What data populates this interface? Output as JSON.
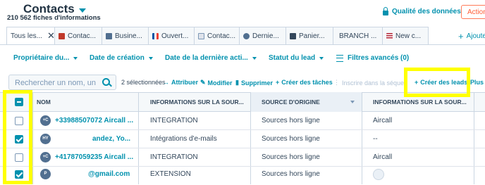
{
  "header": {
    "title": "Contacts",
    "count": "210 562 fiches d'informations",
    "quality_label": "Qualité des données",
    "actions_label": "Action"
  },
  "tabs": [
    {
      "label": "Tous les...",
      "icon": "none",
      "active": true,
      "closable": true
    },
    {
      "label": "Contac...",
      "icon": "briefcase-icon",
      "color": "#c0392b"
    },
    {
      "label": "Busine...",
      "icon": "briefcase-icon",
      "color": "#516f90"
    },
    {
      "label": "Ouvert...",
      "icon": "flag-fr-icon",
      "color": "#0055a4"
    },
    {
      "label": "Contac...",
      "icon": "envelope-icon",
      "color": "#cbd6e2"
    },
    {
      "label": "Dernie...",
      "icon": "speech-icon",
      "color": "#516f90"
    },
    {
      "label": "Panier...",
      "icon": "cart-icon",
      "color": "#33475b"
    },
    {
      "label": "BRANCH ...",
      "icon": "none"
    },
    {
      "label": "New c...",
      "icon": "flag-us-icon",
      "color": "#b22234"
    }
  ],
  "add_view_label": "Ajoute",
  "filters": [
    {
      "label": "Propriétaire du..."
    },
    {
      "label": "Date de création"
    },
    {
      "label": "Date de la dernière acti..."
    },
    {
      "label": "Statut du lead"
    }
  ],
  "advanced_filters_label": "Filtres avancés (0)",
  "search": {
    "placeholder": "Rechercher un nom, un n",
    "value": ""
  },
  "bulk_actions": {
    "selected": "2 sélectionnées",
    "assign": "Attribuer",
    "edit": "Modifier",
    "delete": "Supprimer",
    "create_tasks": "Créer des tâches",
    "enroll_sequence": "Inscrire dans la séquence",
    "create_leads": "Créer des leads",
    "more": "Plus"
  },
  "columns": {
    "name": "NOM",
    "source_info_1": "INFORMATIONS SUR LA SOUR...",
    "origin_source": "SOURCE D'ORIGINE",
    "source_info_2": "INFORMATIONS SUR LA SOUR..."
  },
  "rows": [
    {
      "initials": "+C",
      "name": "+33988507072 Aircall ...",
      "info1": "INTEGRATION",
      "origin": "Sources hors ligne",
      "info2": "Aircall",
      "checked": false
    },
    {
      "initials": "HY",
      "name": "andez, Yo...",
      "info1": "Intégrations d'e-mails",
      "origin": "Sources hors ligne",
      "info2": "--",
      "checked": true
    },
    {
      "initials": "+C",
      "name": "+41787059235 Aircall ...",
      "info1": "INTEGRATION",
      "origin": "Sources hors ligne",
      "info2": "Aircall",
      "checked": false
    },
    {
      "initials": "P",
      "name": "@gmail.com",
      "info1": "EXTENSION",
      "origin": "Sources hors ligne",
      "info2": "",
      "checked": true
    }
  ],
  "colors": {
    "accent": "#0091ae",
    "highlight": "#ffff00",
    "cta": "#ff7a59"
  }
}
